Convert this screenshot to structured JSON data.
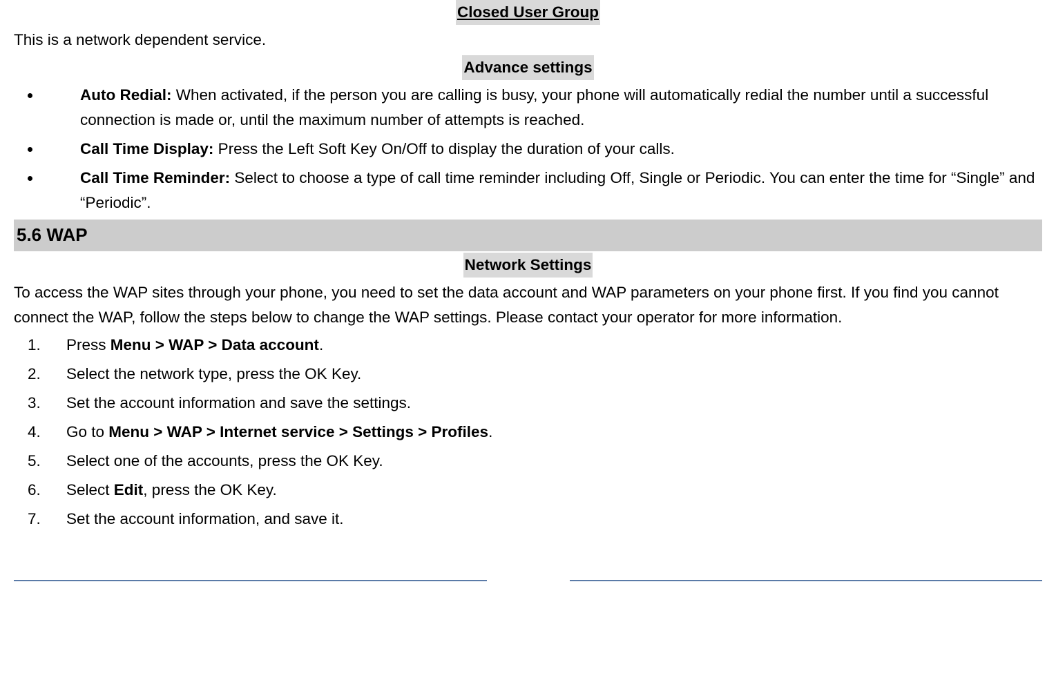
{
  "closedUserGroup": {
    "heading": "Closed User Group",
    "text": "This is a network dependent service."
  },
  "advanceSettings": {
    "heading": "Advance settings",
    "items": [
      {
        "label": "Auto Redial: ",
        "desc": "When activated, if the person you are calling is busy, your phone will automatically redial the number until a successful connection is made or, until the maximum number of attempts is reached."
      },
      {
        "label": "Call Time Display: ",
        "desc": "Press the Left Soft Key On/Off to display the duration of your calls."
      },
      {
        "label": "Call Time Reminder: ",
        "desc": "Select to choose a type of call time reminder including Off, Single or Periodic. You can enter the time for “Single” and “Periodic”."
      }
    ]
  },
  "wapSection": {
    "heading": "5.6 WAP",
    "networkSettingsHeading": "Network Settings",
    "intro": "To access the WAP sites through your phone, you need to set the data account and WAP parameters on your phone first. If you find you cannot connect the WAP, follow the steps below to change the WAP settings. Please contact your operator for more information.",
    "steps": [
      {
        "pre": "Press ",
        "bold": "Menu > WAP > Data account",
        "post": "."
      },
      {
        "pre": "Select the network type, press the OK Key.",
        "bold": "",
        "post": ""
      },
      {
        "pre": "Set the account information and save the settings.",
        "bold": "",
        "post": ""
      },
      {
        "pre": "Go to ",
        "bold": "Menu > WAP > Internet service > Settings > Profiles",
        "post": "."
      },
      {
        "pre": "Select one of the accounts, press the OK Key.",
        "bold": "",
        "post": ""
      },
      {
        "pre": "Select ",
        "bold": "Edit",
        "post": ", press the OK Key."
      },
      {
        "pre": "Set the account information, and save it.",
        "bold": "",
        "post": ""
      }
    ]
  }
}
